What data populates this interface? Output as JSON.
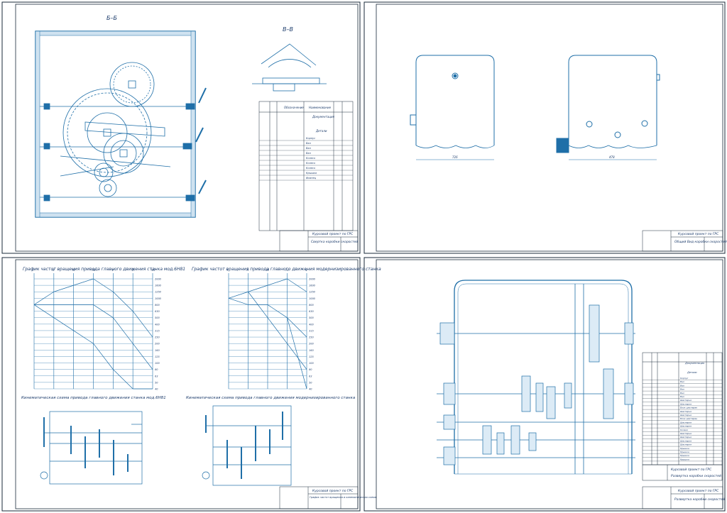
{
  "colors": {
    "line": "#1f6fa8",
    "dark": "#1a2a3a",
    "bg": "#ffffff"
  },
  "sheet1": {
    "section_bb": "Б–Б",
    "section_vv": "В–В",
    "stamp_title": "Курсовой проект по ГРС",
    "stamp_sub": "Свертка коробки скоростей",
    "spec_heading_doc": "Документация",
    "spec_heading_parts": "Детали",
    "spec_col_name": "Наименование",
    "spec_col_designation": "Обозначение",
    "spec_items": [
      "Корпус",
      "Вал",
      "Вал",
      "Вал",
      "Колесо",
      "Колесо",
      "Колесо",
      "Крышка",
      "Фланец"
    ]
  },
  "sheet2": {
    "stamp_title": "Курсовой проект по ГРС",
    "stamp_sub": "Общий Вид коробки скоростей",
    "dim_left": "726",
    "dim_right": "478"
  },
  "sheet3": {
    "chart_left_title": "График частот вращения привода главного движения станка мод.6Н81",
    "chart_right_title": "График частот вращения привода главного движения модернизированного станка",
    "kin_left_title": "Кинематическая схема привода главного движения станка мод.6Н81",
    "kin_right_title": "Кинематическая схема привода главного движения модернизированного станка",
    "roman_left": [
      "I",
      "II",
      "III",
      "IV",
      "V",
      "VI",
      "VII"
    ],
    "roman_right": [
      "I",
      "II",
      "III",
      "IV",
      "V"
    ],
    "speeds": [
      "2000",
      "1600",
      "1250",
      "1000",
      "800",
      "630",
      "500",
      "400",
      "315",
      "250",
      "200",
      "160",
      "125",
      "100",
      "80",
      "63",
      "50",
      "40"
    ],
    "stamp_title": "Курсовой проект по ГРС",
    "stamp_sub": "График частот вращения и кинематическая схема"
  },
  "sheet4": {
    "stamp_title": "Курсовой проект по ГРС",
    "stamp_sub": "Развертка коробки скоростей",
    "spec_heading_doc": "Документация",
    "spec_heading_parts": "Детали",
    "spec_items": [
      "Корпус",
      "Вал",
      "Вал",
      "Вал",
      "Вал",
      "Вал",
      "Шестерня",
      "Шестерня",
      "Блок шестерен",
      "Шестерня",
      "Шестерня",
      "Блок шестерен",
      "Шестерня",
      "Шестерня",
      "Колесо",
      "Шестерня",
      "Шестерня",
      "Шестерня",
      "Шестерня",
      "Крышка",
      "Крышка",
      "Крышка",
      "Крышка"
    ]
  }
}
